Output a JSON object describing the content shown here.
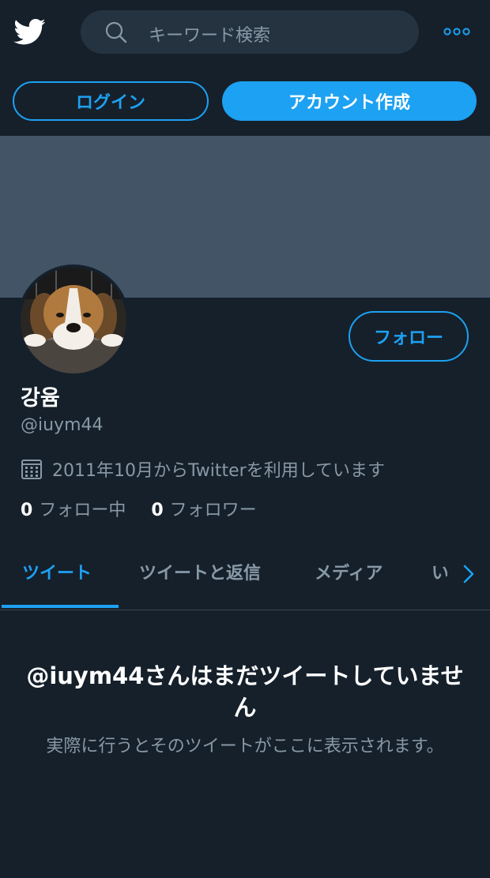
{
  "header": {
    "search_placeholder": "キーワード検索"
  },
  "auth": {
    "login_label": "ログイン",
    "signup_label": "アカウント作成"
  },
  "profile": {
    "name": "강윰",
    "handle": "@iuym44",
    "joined": "2011年10月からTwitterを利用しています",
    "follow_label": "フォロー",
    "following_count": "0",
    "following_label": "フォロー中",
    "followers_count": "0",
    "followers_label": "フォロワー"
  },
  "tabs": [
    {
      "label": "ツイート",
      "active": true
    },
    {
      "label": "ツイートと返信",
      "active": false
    },
    {
      "label": "メディア",
      "active": false
    },
    {
      "label": "い",
      "active": false
    }
  ],
  "empty_state": {
    "title": "@iuym44さんはまだツイートしていません",
    "subtitle": "実際に行うとそのツイートがここに表示されます。"
  },
  "icons": [
    "twitter-bird-icon",
    "search-icon",
    "more-dots-icon",
    "calendar-icon",
    "chevron-right-icon"
  ],
  "colors": {
    "background": "#15202b",
    "accent": "#1da1f2",
    "secondary_text": "#8899a6",
    "banner": "#425466"
  }
}
